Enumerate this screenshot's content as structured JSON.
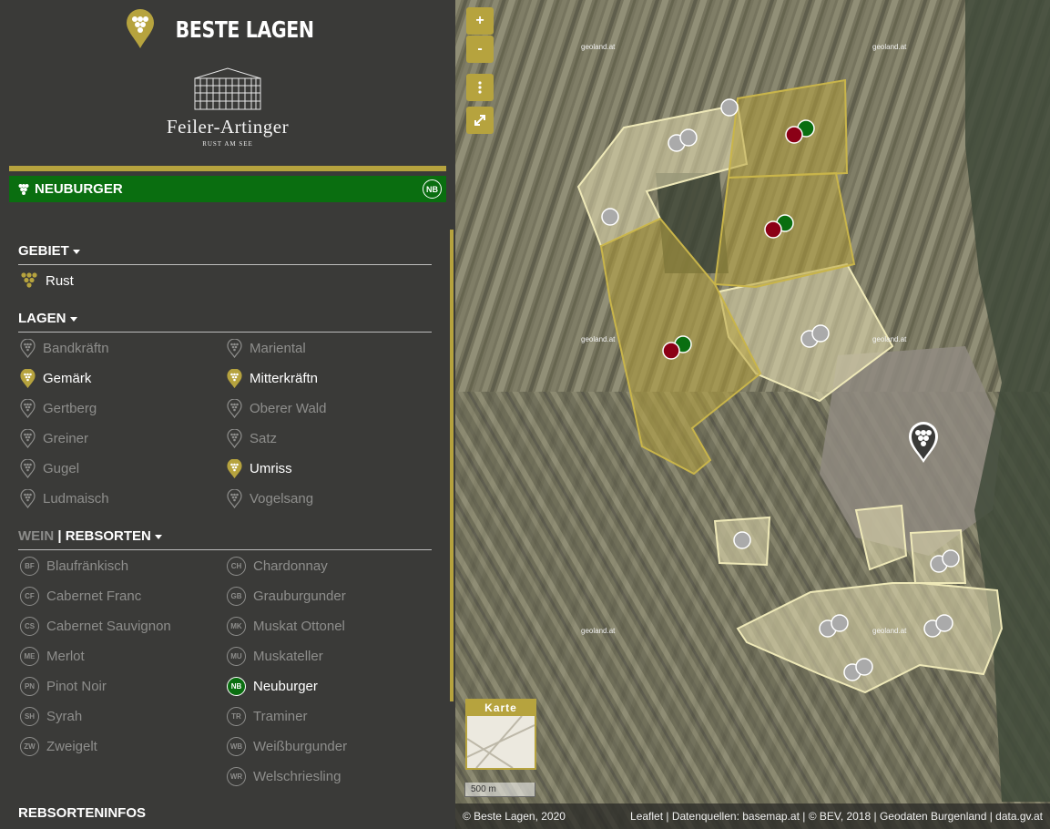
{
  "brand": {
    "title": "BESTE LAGEN"
  },
  "winery": {
    "name": "Feiler-Artinger",
    "location": "RUST AM SEE"
  },
  "banner": {
    "label": "NEUBURGER",
    "badge": "NB"
  },
  "gebiet": {
    "heading": "GEBIET",
    "items": [
      {
        "label": "Rust"
      }
    ]
  },
  "lagen": {
    "heading": "LAGEN",
    "left": [
      {
        "label": "Bandkräftn",
        "state": "dim"
      },
      {
        "label": "Gemärk",
        "state": "on"
      },
      {
        "label": "Gertberg",
        "state": "dim"
      },
      {
        "label": "Greiner",
        "state": "dim"
      },
      {
        "label": "Gugel",
        "state": "dim"
      },
      {
        "label": "Ludmaisch",
        "state": "dim"
      }
    ],
    "right": [
      {
        "label": "Mariental",
        "state": "dim"
      },
      {
        "label": "Mitterkräftn",
        "state": "on"
      },
      {
        "label": "Oberer Wald",
        "state": "dim"
      },
      {
        "label": "Satz",
        "state": "dim"
      },
      {
        "label": "Umriss",
        "state": "on"
      },
      {
        "label": "Vogelsang",
        "state": "dim"
      }
    ]
  },
  "rebsorten": {
    "heading_prefix": "WEIN",
    "heading_sep": " | ",
    "heading": "REBSORTEN",
    "left": [
      {
        "code": "BF",
        "label": "Blaufränkisch"
      },
      {
        "code": "CF",
        "label": "Cabernet Franc"
      },
      {
        "code": "CS",
        "label": "Cabernet Sauvignon"
      },
      {
        "code": "ME",
        "label": "Merlot"
      },
      {
        "code": "PN",
        "label": "Pinot Noir"
      },
      {
        "code": "SH",
        "label": "Syrah"
      },
      {
        "code": "ZW",
        "label": "Zweigelt"
      }
    ],
    "right": [
      {
        "code": "CH",
        "label": "Chardonnay"
      },
      {
        "code": "GB",
        "label": "Grauburgunder"
      },
      {
        "code": "MK",
        "label": "Muskat Ottonel"
      },
      {
        "code": "MU",
        "label": "Muskateller"
      },
      {
        "code": "NB",
        "label": "Neuburger",
        "selected": true
      },
      {
        "code": "TR",
        "label": "Traminer"
      },
      {
        "code": "WB",
        "label": "Weißburgunder"
      },
      {
        "code": "WR",
        "label": "Welschriesling"
      }
    ]
  },
  "next_section": {
    "heading": "REBSORTENINFOS"
  },
  "map": {
    "zoom_in": "+",
    "zoom_out": "-",
    "minimap_label": "Karte",
    "scale": "500 m",
    "watermark": "geoland.at",
    "attribution_left": "© Beste Lagen, 2020",
    "attribution_right": "Leaflet | Datenquellen: basemap.at | © BEV, 2018 | Geodaten Burgenland | data.gv.at"
  },
  "colors": {
    "accent": "#b6a33e",
    "selected": "#0a6e10",
    "red_marker": "#8b0016",
    "grey_marker": "#aaaaaa"
  }
}
